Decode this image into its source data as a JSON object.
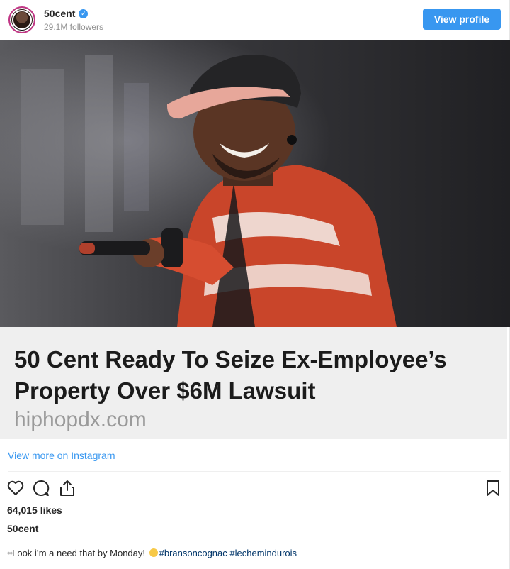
{
  "header": {
    "username": "50cent",
    "verified_mark": "✓",
    "followers": "29.1M followers",
    "view_profile_label": "View profile"
  },
  "media": {
    "description_icon": "photo-of-performer-with-microphone"
  },
  "preview": {
    "headline": "50 Cent Ready To Seize Ex-Employee’s Property Over $6M Lawsuit",
    "domain": "hiphopdx.com"
  },
  "view_more_label": "View more on Instagram",
  "actions": {
    "icons": [
      "heart-icon",
      "comment-icon",
      "share-icon",
      "bookmark-icon"
    ]
  },
  "likes": "64,015 likes",
  "author": "50cent",
  "caption": {
    "dots": "••",
    "text": "Look i’m a need that by Monday!",
    "hashtags": [
      "#bransoncognac",
      "#lechemindurois"
    ]
  },
  "colors": {
    "accent": "#3897f0",
    "text": "#262626",
    "muted": "#8e8e8e",
    "preview_bg": "#efefef",
    "hashtag": "#003569"
  }
}
